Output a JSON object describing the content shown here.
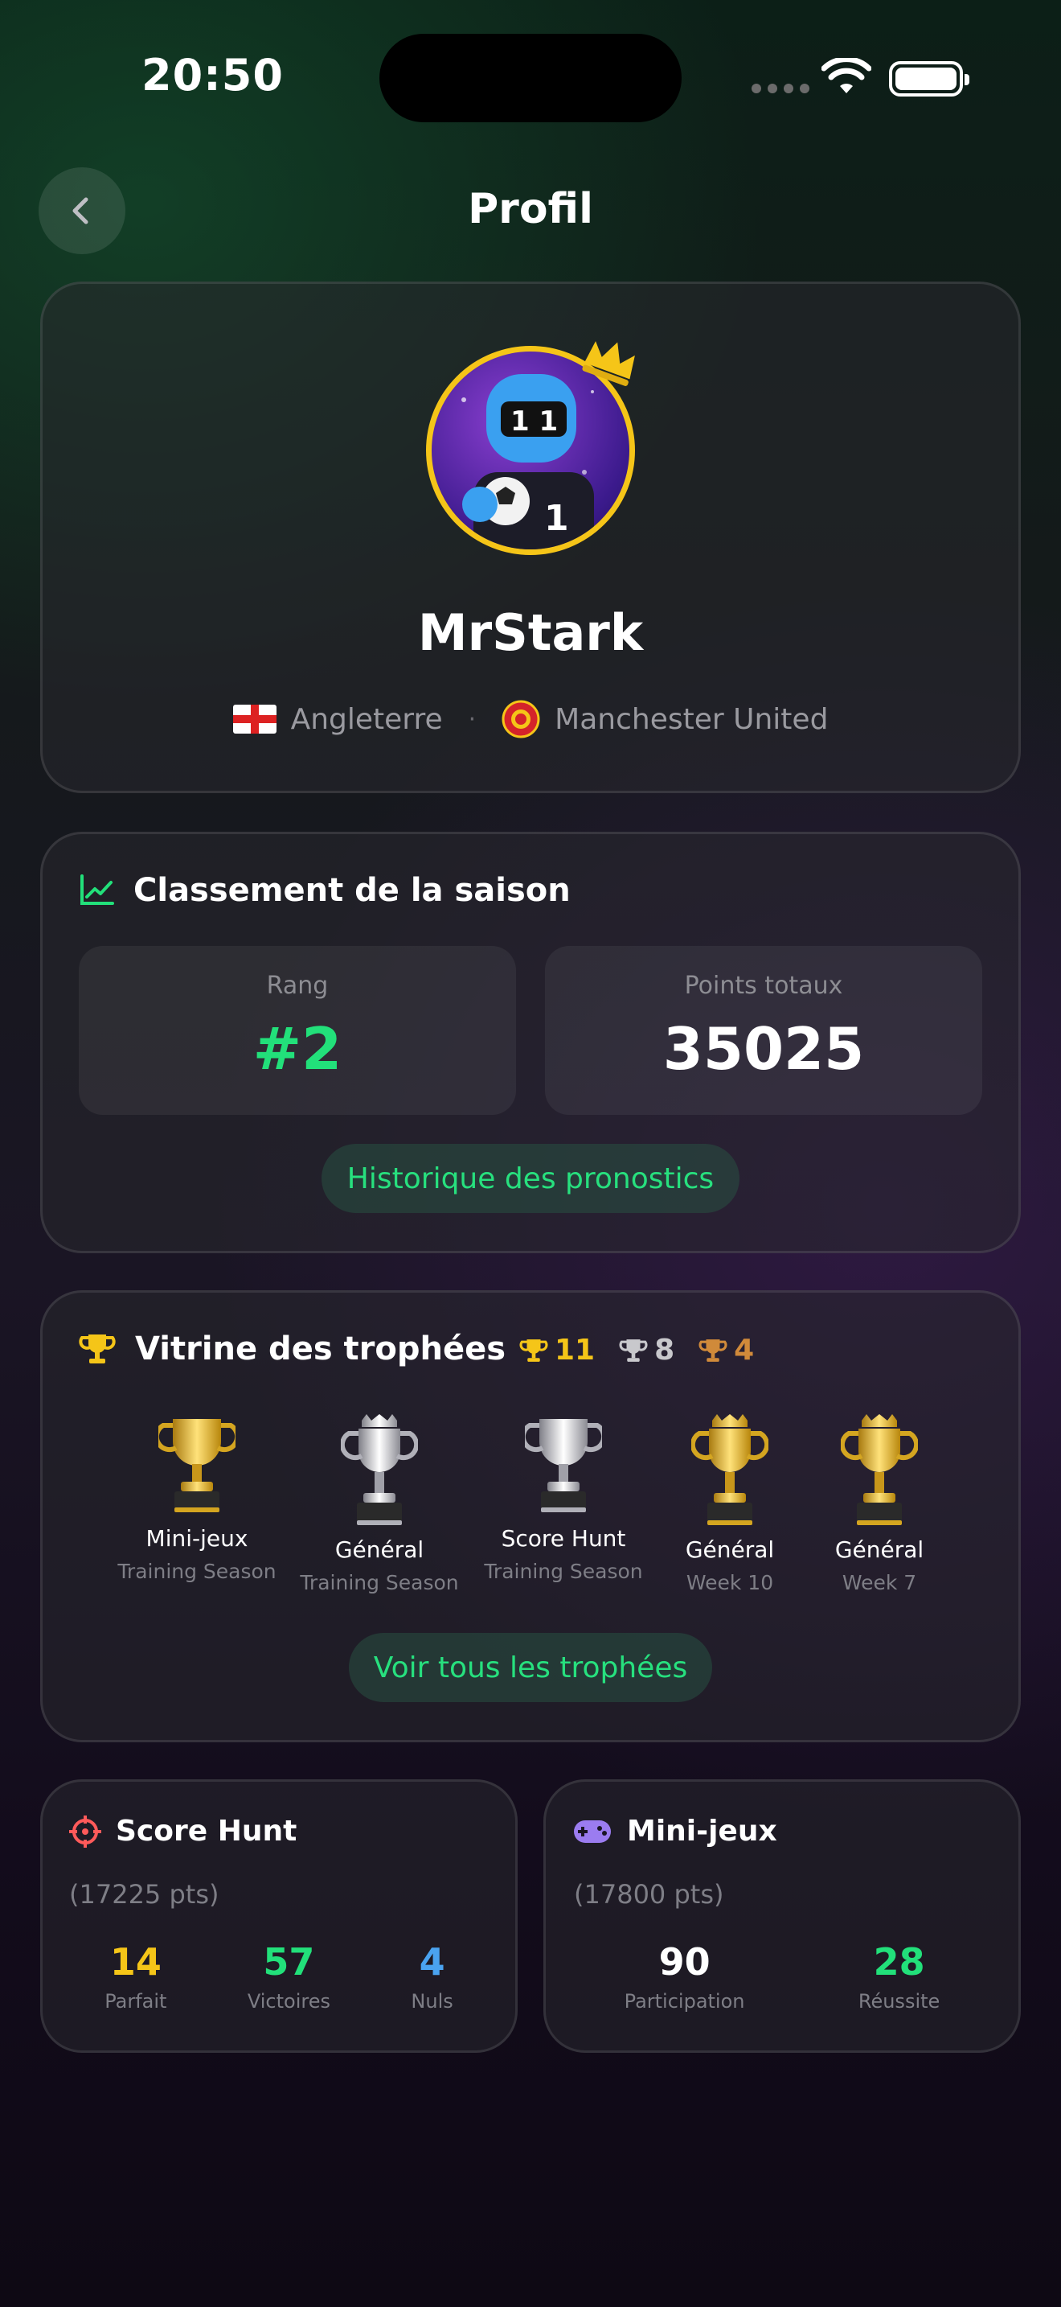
{
  "status_bar": {
    "time": "20:50"
  },
  "header": {
    "title": "Profil"
  },
  "profile": {
    "username": "MrStark",
    "country": "Angleterre",
    "separator": "·",
    "club": "Manchester United"
  },
  "season": {
    "title": "Classement de la saison",
    "rank_label": "Rang",
    "rank_value": "#2",
    "points_label": "Points totaux",
    "points_value": "35025",
    "history_button": "Historique des pronostics"
  },
  "trophies": {
    "title": "Vitrine des trophées",
    "counts": {
      "gold": "11",
      "silver": "8",
      "bronze": "4"
    },
    "items": [
      {
        "name": "Mini-jeux",
        "season": "Training Season",
        "type": "gold"
      },
      {
        "name": "Général",
        "season": "Training Season",
        "type": "silver"
      },
      {
        "name": "Score Hunt",
        "season": "Training Season",
        "type": "silver"
      },
      {
        "name": "Général",
        "season": "Week 10",
        "type": "gold"
      },
      {
        "name": "Général",
        "season": "Week 7",
        "type": "gold"
      }
    ],
    "all_button": "Voir tous les trophées"
  },
  "score_hunt": {
    "title": "Score Hunt",
    "points": "(17225 pts)",
    "stats": [
      {
        "value": "14",
        "label": "Parfait",
        "color": "#f5c518"
      },
      {
        "value": "57",
        "label": "Victoires",
        "color": "#22e07a"
      },
      {
        "value": "4",
        "label": "Nuls",
        "color": "#4aa3f0"
      }
    ]
  },
  "mini_games": {
    "title": "Mini-jeux",
    "points": "(17800 pts)",
    "stats": [
      {
        "value": "90",
        "label": "Participation",
        "color": "#ffffff"
      },
      {
        "value": "28",
        "label": "Réussite",
        "color": "#22e07a"
      }
    ]
  },
  "colors": {
    "accent_green": "#22e07a",
    "gold": "#f5c518",
    "silver": "#c8c8cc",
    "bronze": "#d08a3a",
    "hunt_red": "#ff5a5a",
    "game_purple": "#9b7cf0"
  }
}
